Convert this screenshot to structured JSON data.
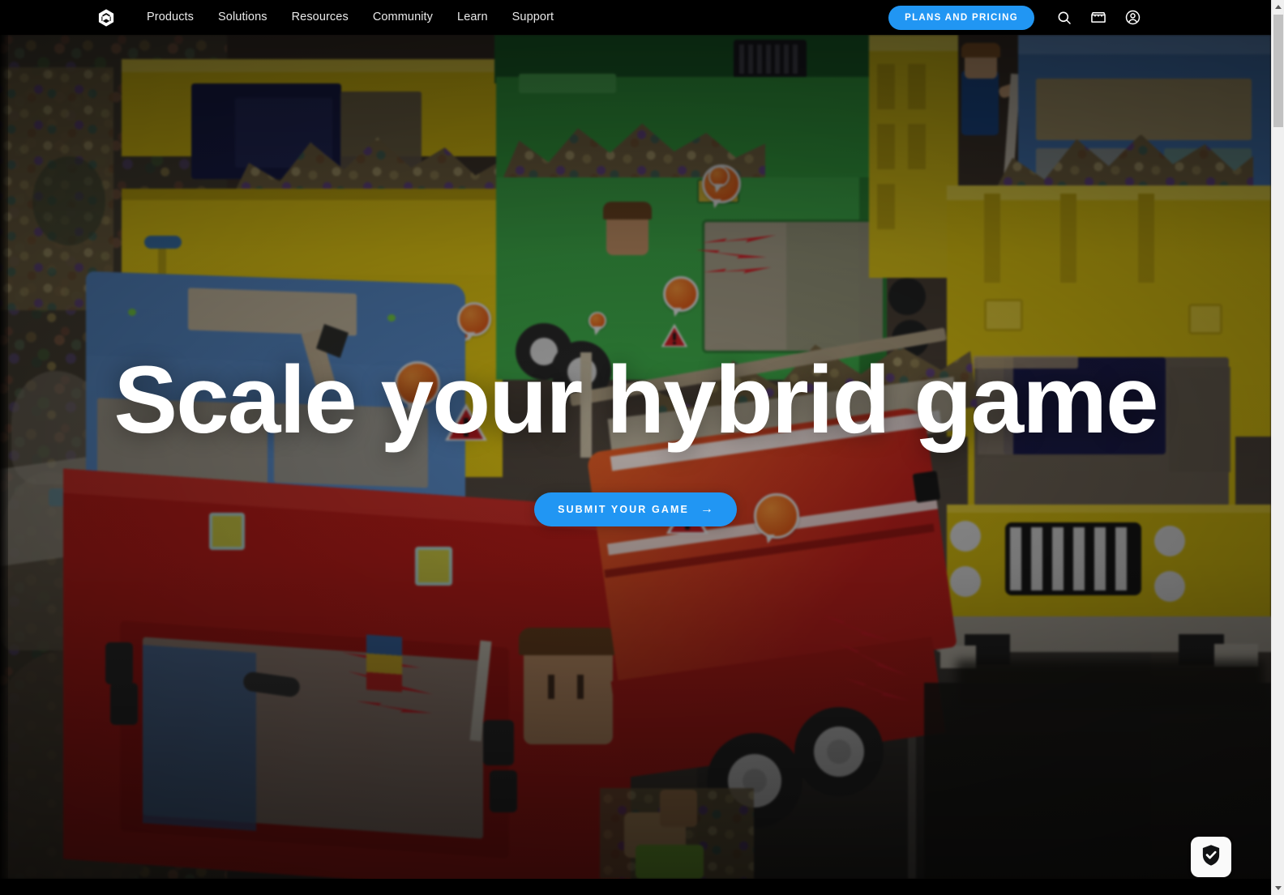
{
  "site": {
    "brand": "Unity",
    "logo_icon": "unity-cube-logo"
  },
  "header": {
    "nav_items": [
      {
        "label": "Products"
      },
      {
        "label": "Solutions"
      },
      {
        "label": "Resources"
      },
      {
        "label": "Community"
      },
      {
        "label": "Learn"
      },
      {
        "label": "Support"
      }
    ],
    "pricing_button": "PLANS AND PRICING",
    "icons": [
      {
        "name": "search-icon",
        "title": "Search"
      },
      {
        "name": "store-icon",
        "title": "Store"
      },
      {
        "name": "account-icon",
        "title": "Account"
      }
    ],
    "background_color": "#000000",
    "accent_color": "#2196f3"
  },
  "hero": {
    "title": "Scale your hybrid game",
    "cta_label": "SUBMIT YOUR GAME",
    "cta_arrow": "→",
    "cta_color": "#2196f3",
    "title_color": "#ffffff",
    "scene_description": "Low-poly garbage trucks at a landfill"
  },
  "overlays": {
    "consent_badge_icon": "shield-check-icon"
  },
  "scrollbar": {
    "up_arrow_icon": "chevron-up-icon",
    "down_arrow_icon": "chevron-down-icon",
    "track_color": "#f0f0f0",
    "thumb_color": "#c1c1c1"
  }
}
